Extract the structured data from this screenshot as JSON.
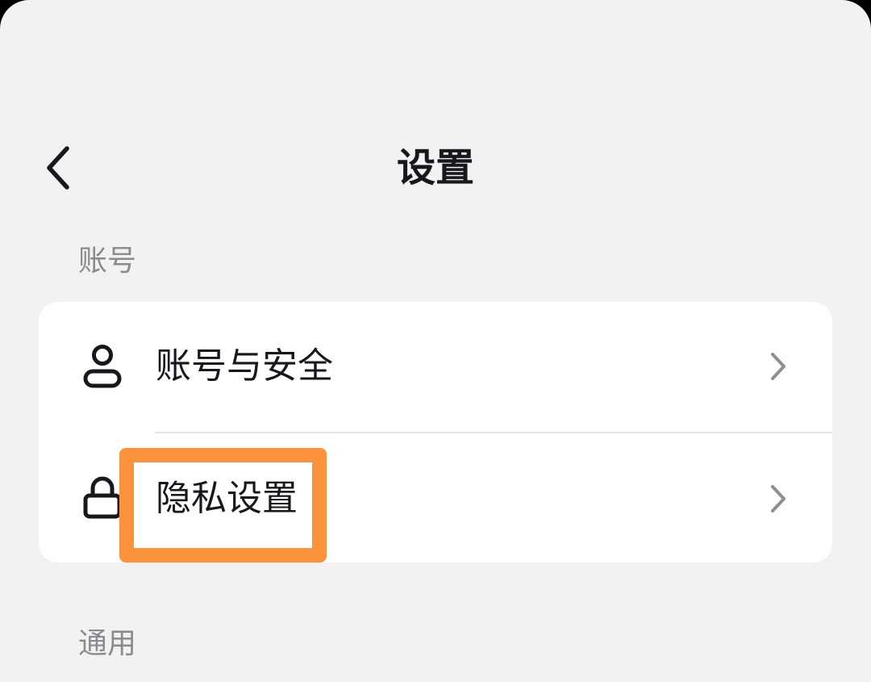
{
  "header": {
    "title": "设置",
    "back_icon": "chevron-left-icon"
  },
  "sections": [
    {
      "header": "账号",
      "items": [
        {
          "label": "账号与安全",
          "icon": "person-icon"
        },
        {
          "label": "隐私设置",
          "icon": "lock-icon"
        }
      ]
    },
    {
      "header": "通用"
    }
  ],
  "colors": {
    "background": "#f2f2f2",
    "card": "#ffffff",
    "text": "#16181d",
    "section_header": "#8a8b8f",
    "chevron": "#8e8e93",
    "highlight": "#fb923c"
  }
}
